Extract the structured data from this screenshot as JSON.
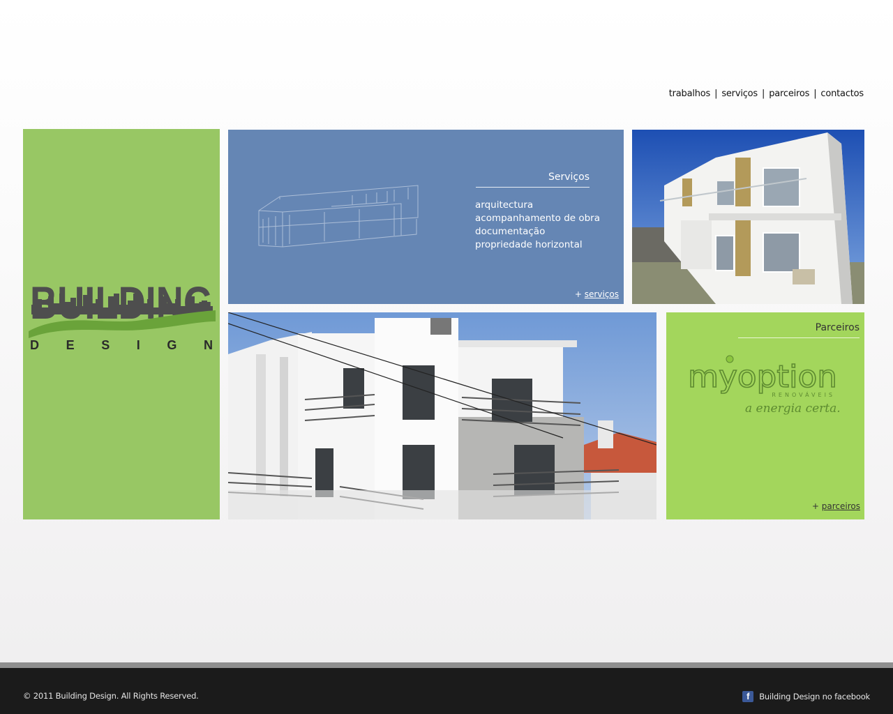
{
  "nav": {
    "items": [
      "trabalhos",
      "serviços",
      "parceiros",
      "contactos"
    ],
    "separator": "|"
  },
  "logo": {
    "word": "BUILDING",
    "sub": "D E S I G N"
  },
  "servicos": {
    "title": "Serviços",
    "items": [
      "arquitectura",
      "acompanhamento de obra",
      "documentação",
      "propriedade horizontal"
    ],
    "more_prefix": "+",
    "more_label": "serviços"
  },
  "parceiros": {
    "title": "Parceiros",
    "partner_logo_text": "myoption",
    "partner_logo_sub": "RENOVÁVEIS",
    "partner_tagline": "a energia certa.",
    "more_prefix": "+",
    "more_label": "parceiros"
  },
  "footer": {
    "copyright": "© 2011 Building Design. All Rights Reserved.",
    "facebook_label": "Building Design no facebook",
    "facebook_icon": "facebook-icon"
  },
  "colors": {
    "logo_panel": "#98c764",
    "services_panel": "#6586b4",
    "partners_panel": "#a3d65c",
    "footer": "#1b1b1b"
  }
}
